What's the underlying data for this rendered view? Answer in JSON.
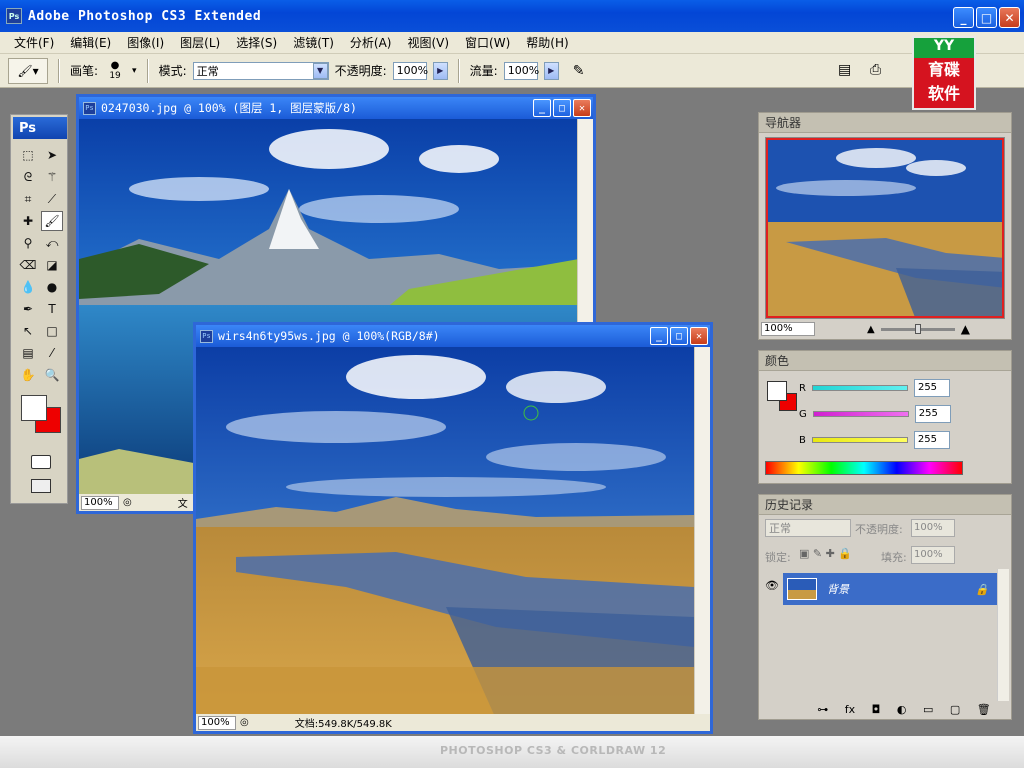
{
  "window": {
    "app_icon": "Ps",
    "title": "Adobe Photoshop CS3 Extended",
    "minimize": "_",
    "maximize": "□",
    "close": "✕"
  },
  "menu": [
    "文件(F)",
    "编辑(E)",
    "图像(I)",
    "图层(L)",
    "选择(S)",
    "滤镜(T)",
    "分析(A)",
    "视图(V)",
    "窗口(W)",
    "帮助(H)"
  ],
  "options": {
    "brush_label": "画笔:",
    "brush_size": "19",
    "mode_label": "模式:",
    "mode_value": "正常",
    "opacity_label": "不透明度:",
    "opacity_value": "100%",
    "flow_label": "流量:",
    "flow_value": "100%"
  },
  "logo": {
    "top": "YY",
    "line1": "育碟",
    "line2": "软件"
  },
  "toolbox": {
    "badge": "Ps"
  },
  "doc1": {
    "title": "0247030.jpg @ 100% (图层 1, 图层蒙版/8)",
    "zoom": "100%",
    "status_extra": "文"
  },
  "doc2": {
    "title": "wirs4n6ty95ws.jpg @ 100%(RGB/8#)",
    "zoom": "100%",
    "status_extra": "文档:549.8K/549.8K"
  },
  "navigator": {
    "tab": "导航器",
    "zoom": "100%"
  },
  "color": {
    "tab": "颜色",
    "channels": [
      {
        "label": "R",
        "value": "255",
        "gradient": "#2ee0e0"
      },
      {
        "label": "G",
        "value": "255",
        "gradient": "#e040e0"
      },
      {
        "label": "B",
        "value": "255",
        "gradient": "#f0f020"
      }
    ]
  },
  "layers": {
    "tab": "历史记录",
    "blend_mode": "正常",
    "opacity_label": "不透明度:",
    "opacity_value": "100%",
    "lock_label": "锁定:",
    "fill_label": "填充:",
    "fill_value": "100%",
    "layer_name": "背景",
    "footer_icons": [
      "link-icon",
      "fx-icon",
      "mask-icon",
      "adjustment-icon",
      "group-icon",
      "new-layer-icon",
      "trash-icon"
    ]
  },
  "footer_brand": "PHOTOSHOP CS3 & CORLDRAW 12"
}
